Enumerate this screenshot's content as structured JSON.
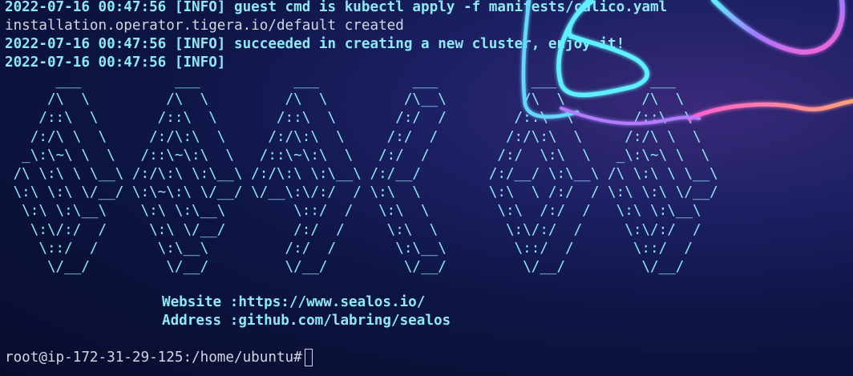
{
  "terminal": {
    "log_lines": [
      "2022-07-16 00:47:56 [INFO] guest cmd is kubectl apply -f manifests/calico.yaml",
      "installation.operator.tigera.io/default created",
      "2022-07-16 00:47:56 [INFO] succeeded in creating a new cluster, enjoy it!",
      "2022-07-16 00:47:56 [INFO]"
    ],
    "banner_art": "      ___           ___           ___           ___           ___           ___\n     /\\  \\         /\\  \\         /\\  \\         /\\__\\         /\\  \\         /\\  \\\n    /::\\  \\       /::\\  \\       /::\\  \\       /:/  /        /::\\  \\       /::\\  \\\n   /:/\\ \\  \\     /:/\\:\\  \\     /:/\\:\\  \\     /:/  /        /:/\\:\\  \\     /:/\\ \\  \\\n  _\\:\\~\\ \\  \\   /::\\~\\:\\  \\   /::\\~\\:\\  \\   /:/  /        /:/  \\:\\  \\   _\\:\\~\\ \\  \\\n /\\ \\:\\ \\ \\__\\ /:/\\:\\ \\:\\__\\ /:/\\:\\ \\:\\__\\ /:/__/        /:/__/ \\:\\__\\ /\\ \\:\\ \\ \\__\\\n \\:\\ \\:\\ \\/__/ \\:\\~\\:\\ \\/__/ \\/__\\:\\/:/  / \\:\\  \\        \\:\\  \\ /:/  / \\:\\ \\:\\ \\/__/\n  \\:\\ \\:\\__\\    \\:\\ \\:\\__\\        \\::/  /   \\:\\  \\        \\:\\  /:/  /   \\:\\ \\:\\__\\\n   \\:\\/:/  /     \\:\\ \\/__/        /:/  /     \\:\\  \\        \\:\\/:/  /     \\:\\/:/  /\n    \\::/  /       \\:\\__\\         /:/  /       \\:\\__\\        \\::/  /       \\::/  /\n     \\/__/         \\/__/         \\/__/         \\/__/         \\/__/         \\/__/",
    "website_line": "Website :https://www.sealos.io/",
    "address_line": "Address :github.com/labring/sealos",
    "prompt": "root@ip-172-31-29-125:/home/ubuntu#"
  },
  "colors": {
    "info_text": "#8ee8f6",
    "plain_text": "#d2d6e0",
    "neon_cyan": "#5ef0ff",
    "neon_pink": "#ff5fd2"
  }
}
